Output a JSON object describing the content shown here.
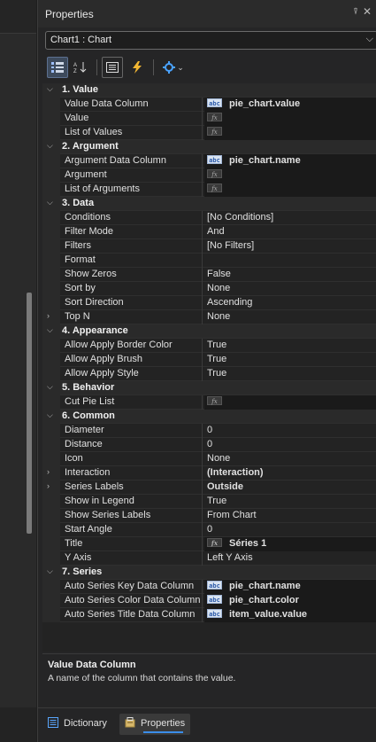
{
  "panel": {
    "title": "Properties"
  },
  "object_selector": {
    "value": "Chart1 : Chart"
  },
  "toolbar": {
    "items": [
      "categorized-view",
      "alphabetical-sort",
      "properties-view",
      "events-view",
      "settings"
    ]
  },
  "categories": [
    {
      "label": "1. Value",
      "rows": [
        {
          "name": "Value Data Column",
          "value": "pie_chart.value",
          "icon": "abc",
          "bold": true
        },
        {
          "name": "Value",
          "value": "",
          "icon": "fx"
        },
        {
          "name": "List of Values",
          "value": "",
          "icon": "fx"
        }
      ]
    },
    {
      "label": "2. Argument",
      "rows": [
        {
          "name": "Argument Data Column",
          "value": "pie_chart.name",
          "icon": "abc",
          "bold": true
        },
        {
          "name": "Argument",
          "value": "",
          "icon": "fx"
        },
        {
          "name": "List of Arguments",
          "value": "",
          "icon": "fx"
        }
      ]
    },
    {
      "label": "3. Data",
      "rows": [
        {
          "name": "Conditions",
          "value": "[No Conditions]"
        },
        {
          "name": "Filter Mode",
          "value": "And"
        },
        {
          "name": "Filters",
          "value": "[No Filters]"
        },
        {
          "name": "Format",
          "value": ""
        },
        {
          "name": "Show Zeros",
          "value": "False"
        },
        {
          "name": "Sort by",
          "value": "None"
        },
        {
          "name": "Sort Direction",
          "value": "Ascending"
        },
        {
          "name": "Top N",
          "value": "None",
          "expandable": true
        }
      ]
    },
    {
      "label": "4. Appearance",
      "rows": [
        {
          "name": "Allow Apply Border Color",
          "value": "True"
        },
        {
          "name": "Allow Apply Brush",
          "value": "True"
        },
        {
          "name": "Allow Apply Style",
          "value": "True"
        }
      ]
    },
    {
      "label": "5. Behavior",
      "rows": [
        {
          "name": "Cut Pie List",
          "value": "",
          "icon": "fx"
        }
      ]
    },
    {
      "label": "6. Common",
      "rows": [
        {
          "name": "Diameter",
          "value": "0"
        },
        {
          "name": "Distance",
          "value": "0"
        },
        {
          "name": "Icon",
          "value": "None"
        },
        {
          "name": "Interaction",
          "value": "(Interaction)",
          "bold": true,
          "expandable": true
        },
        {
          "name": "Series Labels",
          "value": "Outside",
          "bold": true,
          "expandable": true
        },
        {
          "name": "Show in Legend",
          "value": "True"
        },
        {
          "name": "Show Series Labels",
          "value": "From Chart"
        },
        {
          "name": "Start Angle",
          "value": "0"
        },
        {
          "name": "Title",
          "value": "Séries 1",
          "icon": "fx",
          "bold": true
        },
        {
          "name": "Y Axis",
          "value": "Left Y Axis"
        }
      ]
    },
    {
      "label": "7. Series",
      "rows": [
        {
          "name": "Auto Series Key Data Column",
          "value": "pie_chart.name",
          "icon": "abc",
          "bold": true
        },
        {
          "name": "Auto Series Color Data Column",
          "value": "pie_chart.color",
          "icon": "abc",
          "bold": true
        },
        {
          "name": "Auto Series Title Data Column",
          "value": "item_value.value",
          "icon": "abc",
          "bold": true
        }
      ]
    }
  ],
  "description": {
    "title": "Value Data Column",
    "text": "A name of the column that contains the value."
  },
  "bottom_tabs": [
    {
      "label": "Dictionary",
      "active": false
    },
    {
      "label": "Properties",
      "active": true
    }
  ],
  "colors": {
    "accent": "#3b8eea",
    "panel_bg": "#252526",
    "grid_bg": "#232323"
  }
}
